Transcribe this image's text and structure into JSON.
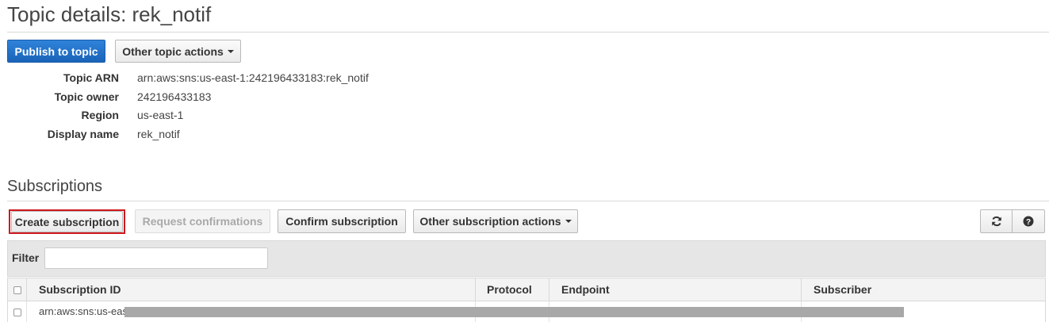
{
  "page": {
    "title": "Topic details: rek_notif"
  },
  "topic_actions": {
    "publish_label": "Publish to topic",
    "other_actions_label": "Other topic actions"
  },
  "details": [
    {
      "label": "Topic ARN",
      "value": "arn:aws:sns:us-east-1:242196433183:rek_notif"
    },
    {
      "label": "Topic owner",
      "value": "242196433183"
    },
    {
      "label": "Region",
      "value": "us-east-1"
    },
    {
      "label": "Display name",
      "value": "rek_notif"
    }
  ],
  "subscriptions": {
    "section_title": "Subscriptions",
    "buttons": {
      "create": "Create subscription",
      "request_confirmations": "Request confirmations",
      "confirm": "Confirm subscription",
      "other_actions": "Other subscription actions"
    },
    "icons": {
      "refresh": "refresh-icon",
      "help": "help-icon"
    },
    "filter": {
      "label": "Filter",
      "value": "",
      "placeholder": ""
    },
    "columns": [
      "Subscription ID",
      "Protocol",
      "Endpoint",
      "Subscriber"
    ],
    "rows": [
      {
        "subscription_id": "arn:aws:sns:us-eas",
        "protocol": "",
        "endpoint": "",
        "subscriber": ""
      }
    ]
  },
  "colors": {
    "primary_button": "#1a63b8",
    "highlight_border": "#d0181f"
  }
}
